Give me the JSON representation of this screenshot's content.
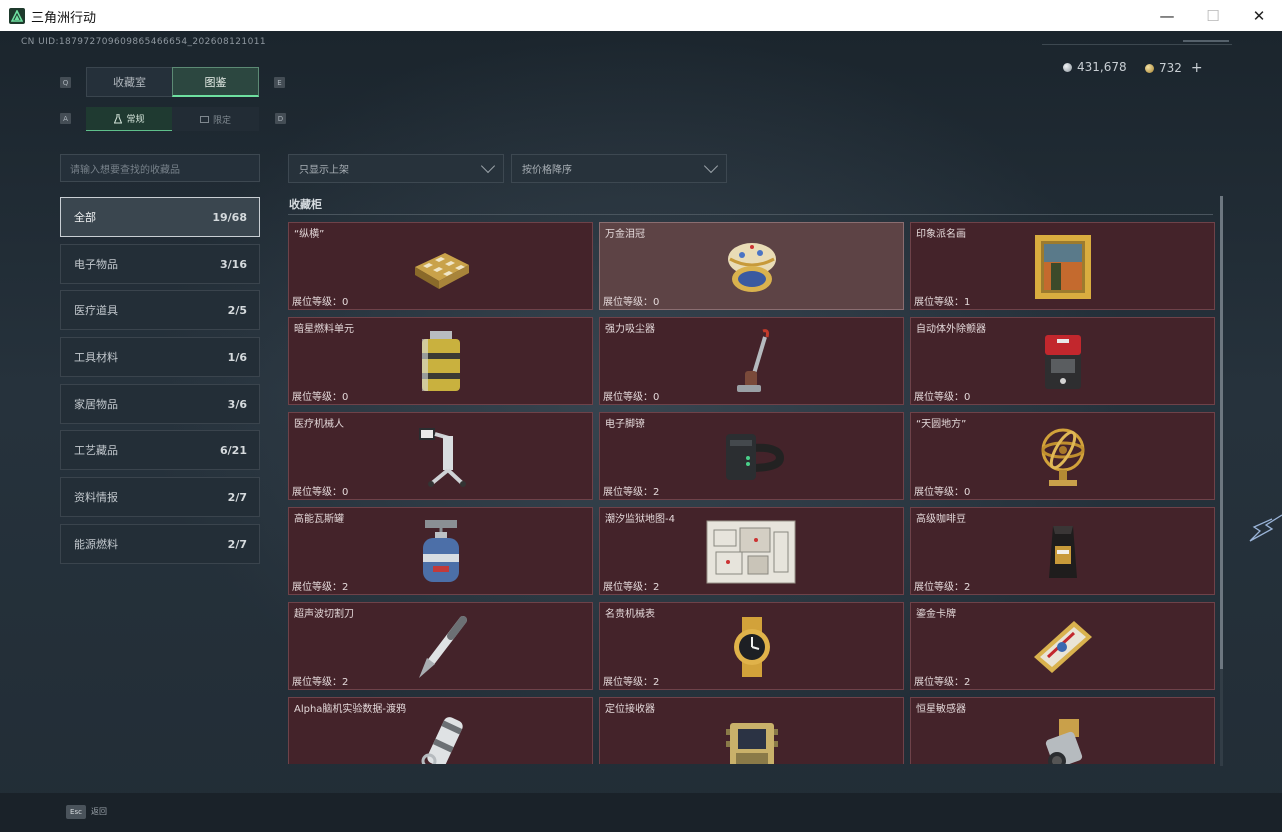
{
  "window": {
    "title": "三角洲行动",
    "minimize": "—",
    "maximize": "☐",
    "close": "✕"
  },
  "header": {
    "uid": "CN UID:187972709609865466654_202608121011",
    "silver": "431,678",
    "gold": "732",
    "plus": "+"
  },
  "tabs": {
    "key_left": "Q",
    "key_right": "E",
    "collection": "收藏室",
    "catalog": "图鉴",
    "sub_key_left": "A",
    "sub_key_right": "D",
    "normal": "常规",
    "limited": "限定"
  },
  "search": {
    "placeholder": "请输入想要查找的收藏品"
  },
  "categories": [
    {
      "label": "全部",
      "count": "19/68"
    },
    {
      "label": "电子物品",
      "count": "3/16"
    },
    {
      "label": "医疗道具",
      "count": "2/5"
    },
    {
      "label": "工具材料",
      "count": "1/6"
    },
    {
      "label": "家居物品",
      "count": "3/6"
    },
    {
      "label": "工艺藏品",
      "count": "6/21"
    },
    {
      "label": "资料情报",
      "count": "2/7"
    },
    {
      "label": "能源燃料",
      "count": "2/7"
    }
  ],
  "filters": {
    "shelf": "只显示上架",
    "sort": "按价格降序"
  },
  "section": {
    "title": "收藏柜"
  },
  "items": [
    {
      "name": "“纵横”",
      "level": "展位等级：0",
      "icon": "chess-box-icon"
    },
    {
      "name": "万金泪冠",
      "level": "展位等级：0",
      "icon": "jeweled-egg-icon"
    },
    {
      "name": "印象派名画",
      "level": "展位等级：1",
      "icon": "framed-painting-icon"
    },
    {
      "name": "暗星燃料单元",
      "level": "展位等级：0",
      "icon": "fuel-cell-icon"
    },
    {
      "name": "强力吸尘器",
      "level": "展位等级：0",
      "icon": "vacuum-cleaner-icon"
    },
    {
      "name": "自动体外除颤器",
      "level": "展位等级：0",
      "icon": "defibrillator-icon"
    },
    {
      "name": "医疗机械人",
      "level": "展位等级：0",
      "icon": "medical-robot-icon"
    },
    {
      "name": "电子脚镣",
      "level": "展位等级：2",
      "icon": "ankle-monitor-icon"
    },
    {
      "name": "“天圆地方”",
      "level": "展位等级：0",
      "icon": "armillary-sphere-icon"
    },
    {
      "name": "高能瓦斯罐",
      "level": "展位等级：2",
      "icon": "gas-canister-icon"
    },
    {
      "name": "潮汐监狱地图-4",
      "level": "展位等级：2",
      "icon": "prison-map-icon"
    },
    {
      "name": "高级咖啡豆",
      "level": "展位等级：2",
      "icon": "coffee-bag-icon"
    },
    {
      "name": "超声波切割刀",
      "level": "展位等级：2",
      "icon": "ultrasonic-cutter-icon"
    },
    {
      "name": "名贵机械表",
      "level": "展位等级：2",
      "icon": "luxury-watch-icon"
    },
    {
      "name": "鎏金卡牌",
      "level": "展位等级：2",
      "icon": "gilded-card-icon"
    },
    {
      "name": "Alpha脑机实验数据-渡鸦",
      "level": "",
      "icon": "data-canister-icon"
    },
    {
      "name": "定位接收器",
      "level": "",
      "icon": "locator-receiver-icon"
    },
    {
      "name": "恒星敏感器",
      "level": "",
      "icon": "star-sensor-icon"
    }
  ],
  "footer": {
    "esc_key": "Esc",
    "back": "返回"
  }
}
